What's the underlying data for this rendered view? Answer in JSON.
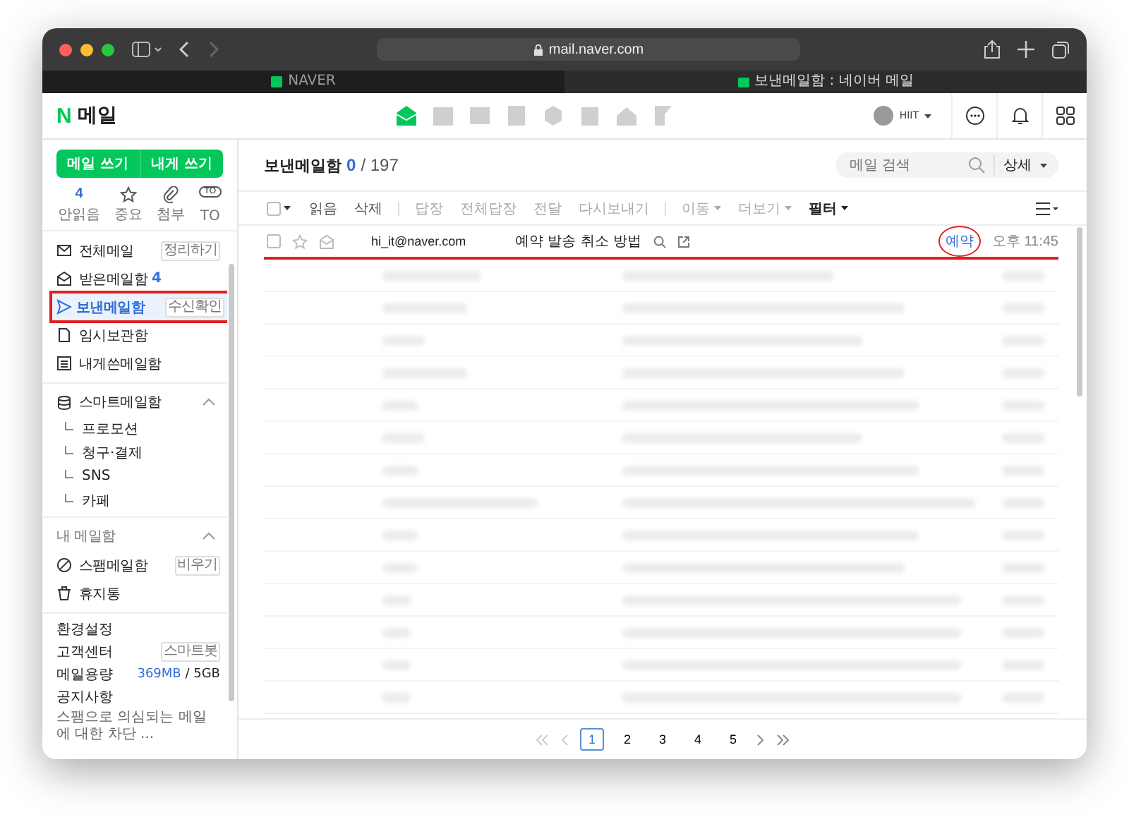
{
  "browser": {
    "url": "mail.naver.com",
    "tabs": [
      {
        "title": "NAVER",
        "kind": "naver",
        "selected": false
      },
      {
        "title": "보낸메일함 : 네이버 메일",
        "kind": "mail",
        "selected": true
      }
    ]
  },
  "header": {
    "logo_letter": "N",
    "logo_text": "메일",
    "apps": [
      {
        "kind": "mail",
        "selected": true
      },
      {
        "kind": "calendar",
        "selected": false
      },
      {
        "kind": "photo",
        "selected": false
      },
      {
        "kind": "contact",
        "selected": false
      },
      {
        "kind": "hex",
        "selected": false
      },
      {
        "kind": "memo",
        "selected": false
      },
      {
        "kind": "home",
        "selected": false
      },
      {
        "kind": "flag",
        "selected": false
      }
    ],
    "profile": "HIIT"
  },
  "sidebar": {
    "write_buttons": [
      "메일 쓰기",
      "내게 쓰기"
    ],
    "quick": [
      {
        "kind": "count",
        "icon_text": "4",
        "label": "안읽음"
      },
      {
        "kind": "star",
        "label": "중요"
      },
      {
        "kind": "clip",
        "label": "첨부"
      },
      {
        "kind": "to",
        "icon_text": "TO",
        "label": "TO"
      }
    ],
    "folders": [
      {
        "kind": "mail",
        "label": "전체메일",
        "action": "정리하기",
        "selected": false,
        "highlighted": false
      },
      {
        "kind": "inbox",
        "label": "받은메일함",
        "count": "4",
        "selected": false,
        "highlighted": false
      },
      {
        "kind": "send",
        "label": "보낸메일함",
        "action": "수신확인",
        "selected": true,
        "highlighted": true
      },
      {
        "kind": "doc",
        "label": "임시보관함",
        "selected": false,
        "highlighted": false
      },
      {
        "kind": "list",
        "label": "내게쓴메일함",
        "selected": false,
        "highlighted": false
      }
    ],
    "smart": {
      "title": "스마트메일함",
      "expanded": true,
      "children": [
        {
          "label": "프로모션"
        },
        {
          "label": "청구·결제"
        },
        {
          "label": "SNS"
        },
        {
          "label": "카페"
        }
      ]
    },
    "my_mailbox": {
      "title": "내 메일함",
      "expanded": true
    },
    "folders2": [
      {
        "kind": "spam",
        "label": "스팸메일함",
        "action": "비우기",
        "selected": false,
        "highlighted": false
      },
      {
        "kind": "trash",
        "label": "휴지통",
        "selected": false,
        "highlighted": false
      }
    ],
    "settings": "환경설정",
    "support": {
      "label": "고객센터",
      "action": "스마트봇"
    },
    "storage": {
      "label": "메일용량",
      "used": "369MB",
      "total": "/ 5GB"
    },
    "notice": {
      "title": "공지사항",
      "text": "스팸으로 의심되는 메일에 대한 차단 ..."
    }
  },
  "main": {
    "select_all": {
      "checked": false
    },
    "title": "보낸메일함",
    "unread": "0",
    "total": "/ 197",
    "search": {
      "placeholder": "메일 검색"
    },
    "detail": "상세",
    "toolbar": [
      [
        {
          "label": "읽음",
          "disabled": false,
          "dropdown": false
        },
        {
          "label": "삭제",
          "disabled": false,
          "dropdown": false
        }
      ],
      [
        {
          "label": "답장",
          "disabled": true,
          "dropdown": false
        },
        {
          "label": "전체답장",
          "disabled": true,
          "dropdown": false
        },
        {
          "label": "전달",
          "disabled": true,
          "dropdown": false
        },
        {
          "label": "다시보내기",
          "disabled": true,
          "dropdown": false
        }
      ],
      [
        {
          "label": "이동",
          "disabled": true,
          "dropdown": true
        },
        {
          "label": "더보기",
          "disabled": true,
          "dropdown": true
        },
        {
          "label": "필터",
          "disabled": false,
          "dropdown": true
        }
      ]
    ],
    "rows": [
      {
        "checked": false,
        "sender": "hi_it@naver.com",
        "subject": "예약 발송 취소 방법",
        "tag": "예약",
        "time": "오후 11:45",
        "underlined": true,
        "tag_circled": true
      }
    ],
    "pages": [
      {
        "label": "1",
        "selected": true
      },
      {
        "label": "2",
        "selected": false
      },
      {
        "label": "3",
        "selected": false
      },
      {
        "label": "4",
        "selected": false
      },
      {
        "label": "5",
        "selected": false
      }
    ]
  }
}
